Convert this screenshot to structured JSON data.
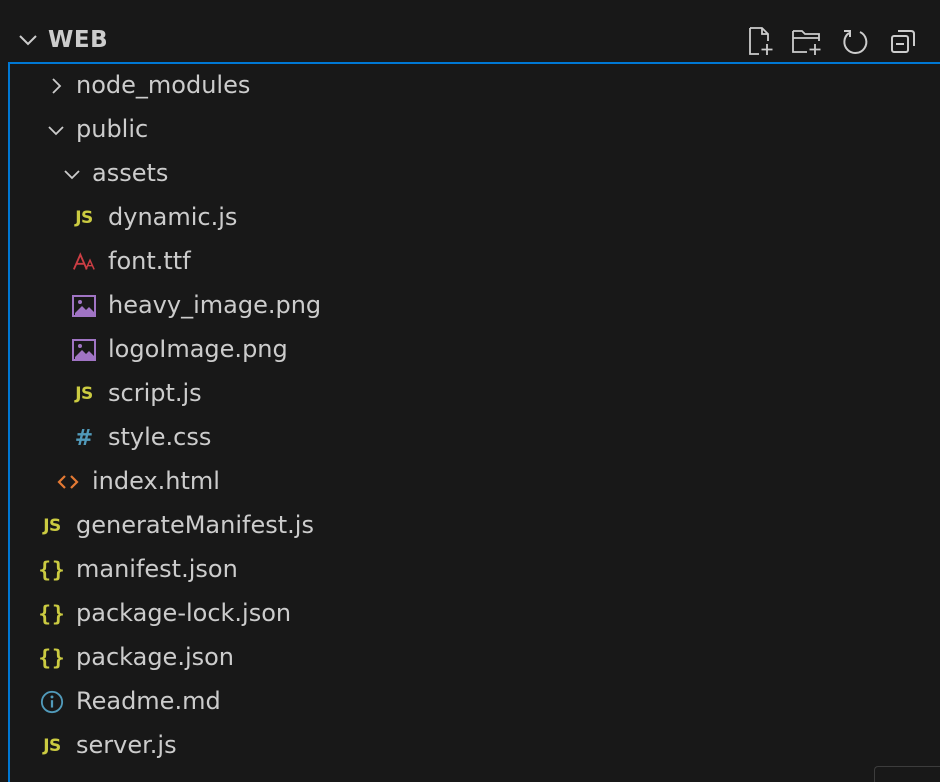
{
  "section": {
    "title": "WEB",
    "expanded": true,
    "actions": [
      {
        "name": "new-file-icon"
      },
      {
        "name": "new-folder-icon"
      },
      {
        "name": "refresh-icon"
      },
      {
        "name": "collapse-all-icon"
      }
    ]
  },
  "colors": {
    "background": "#181818",
    "focus_border": "#0078d4",
    "text": "#cccccc",
    "js": "#cbcb41",
    "json": "#cbcb41",
    "css": "#519aba",
    "font": "#cc3e44",
    "image": "#a074c4",
    "html": "#e37933",
    "info": "#519aba"
  },
  "tree": [
    {
      "label": "node_modules",
      "kind": "folder",
      "expanded": false,
      "icon": "chevron-right-icon"
    },
    {
      "label": "public",
      "kind": "folder",
      "expanded": true,
      "icon": "chevron-down-icon"
    },
    {
      "label": "assets",
      "kind": "folder",
      "expanded": true,
      "icon": "chevron-down-icon"
    },
    {
      "label": "dynamic.js",
      "kind": "file",
      "icon": "js-file-icon",
      "badge": "JS"
    },
    {
      "label": "font.ttf",
      "kind": "file",
      "icon": "font-file-icon",
      "badge": "Aa"
    },
    {
      "label": "heavy_image.png",
      "kind": "file",
      "icon": "image-file-icon"
    },
    {
      "label": "logoImage.png",
      "kind": "file",
      "icon": "image-file-icon"
    },
    {
      "label": "script.js",
      "kind": "file",
      "icon": "js-file-icon",
      "badge": "JS"
    },
    {
      "label": "style.css",
      "kind": "file",
      "icon": "css-file-icon",
      "badge": "#"
    },
    {
      "label": "index.html",
      "kind": "file",
      "icon": "html-file-icon"
    },
    {
      "label": "generateManifest.js",
      "kind": "file",
      "icon": "js-file-icon",
      "badge": "JS"
    },
    {
      "label": "manifest.json",
      "kind": "file",
      "icon": "json-file-icon",
      "badge": "{}"
    },
    {
      "label": "package-lock.json",
      "kind": "file",
      "icon": "json-file-icon",
      "badge": "{}"
    },
    {
      "label": "package.json",
      "kind": "file",
      "icon": "json-file-icon",
      "badge": "{}"
    },
    {
      "label": "Readme.md",
      "kind": "file",
      "icon": "info-icon"
    },
    {
      "label": "server.js",
      "kind": "file",
      "icon": "js-file-icon",
      "badge": "JS"
    }
  ]
}
